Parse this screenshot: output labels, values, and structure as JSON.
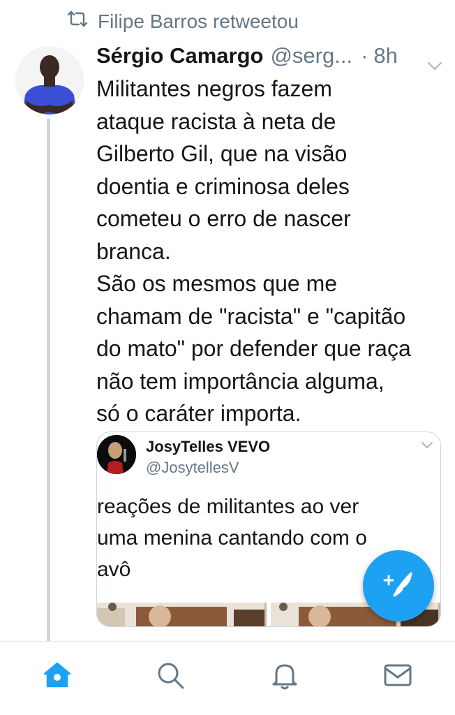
{
  "retweet_context": {
    "icon": "retweet-icon",
    "text": "Filipe Barros retweetou"
  },
  "tweet": {
    "author_name": "Sérgio Camargo",
    "author_handle": "@serg...",
    "separator": "·",
    "time": "8h",
    "avatar_icon": "profile-photo",
    "body_lines": [
      "Militantes negros fazem",
      "ataque racista à neta de",
      "Gilberto Gil, que na visão",
      "doentia e criminosa deles",
      "cometeu o erro de nascer",
      "branca.",
      "São os mesmos que me",
      "chamam de \"racista\" e \"capitão",
      "do mato\" por defender que raça",
      "não tem importância alguma,",
      "só o caráter importa."
    ]
  },
  "quoted_tweet": {
    "author_name": "JosyTelles VEVO",
    "author_handle": "@JosytellesV",
    "text_lines": [
      "reações de militantes ao ver",
      "uma menina cantando com o",
      "avô"
    ]
  },
  "fab": {
    "icon": "compose-tweet-icon"
  },
  "bottom_nav": {
    "items": [
      {
        "icon": "home-icon",
        "active": true
      },
      {
        "icon": "search-icon",
        "active": false
      },
      {
        "icon": "notifications-bell-icon",
        "active": false
      },
      {
        "icon": "messages-envelope-icon",
        "active": false
      }
    ]
  },
  "colors": {
    "accent": "#1da1f2",
    "secondary_text": "#657786",
    "primary_text": "#14171a",
    "divider": "#e1e8ed"
  }
}
